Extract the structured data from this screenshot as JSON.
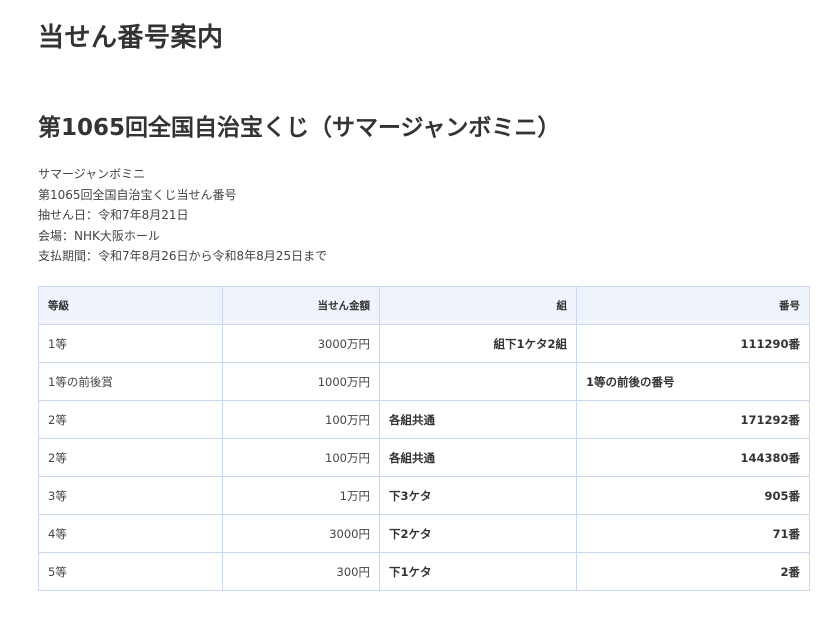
{
  "page": {
    "title": "当せん番号案内"
  },
  "draw": {
    "title": "第1065回全国自治宝くじ（サマージャンボミニ）",
    "info_lines": [
      "サマージャンボミニ",
      "第1065回全国自治宝くじ当せん番号",
      "抽せん日：令和7年8月21日",
      "会場：NHK大阪ホール",
      "支払期間：令和7年8月26日から令和8年8月25日まで"
    ]
  },
  "table": {
    "headers": {
      "grade": "等級",
      "amount": "当せん金額",
      "group": "組",
      "number": "番号"
    },
    "rows": [
      {
        "grade": "1等",
        "amount": "3000万円",
        "group": "組下1ケタ2組",
        "group_align": "right",
        "number": "111290番",
        "number_align": "right"
      },
      {
        "grade": "1等の前後賞",
        "amount": "1000万円",
        "group": "",
        "group_align": "left",
        "number": "1等の前後の番号",
        "number_align": "left"
      },
      {
        "grade": "2等",
        "amount": "100万円",
        "group": "各組共通",
        "group_align": "left",
        "number": "171292番",
        "number_align": "right"
      },
      {
        "grade": "2等",
        "amount": "100万円",
        "group": "各組共通",
        "group_align": "left",
        "number": "144380番",
        "number_align": "right"
      },
      {
        "grade": "3等",
        "amount": "1万円",
        "group": "下3ケタ",
        "group_align": "left",
        "number": "905番",
        "number_align": "right"
      },
      {
        "grade": "4等",
        "amount": "3000円",
        "group": "下2ケタ",
        "group_align": "left",
        "number": "71番",
        "number_align": "right"
      },
      {
        "grade": "5等",
        "amount": "300円",
        "group": "下1ケタ",
        "group_align": "left",
        "number": "2番",
        "number_align": "right"
      }
    ]
  }
}
